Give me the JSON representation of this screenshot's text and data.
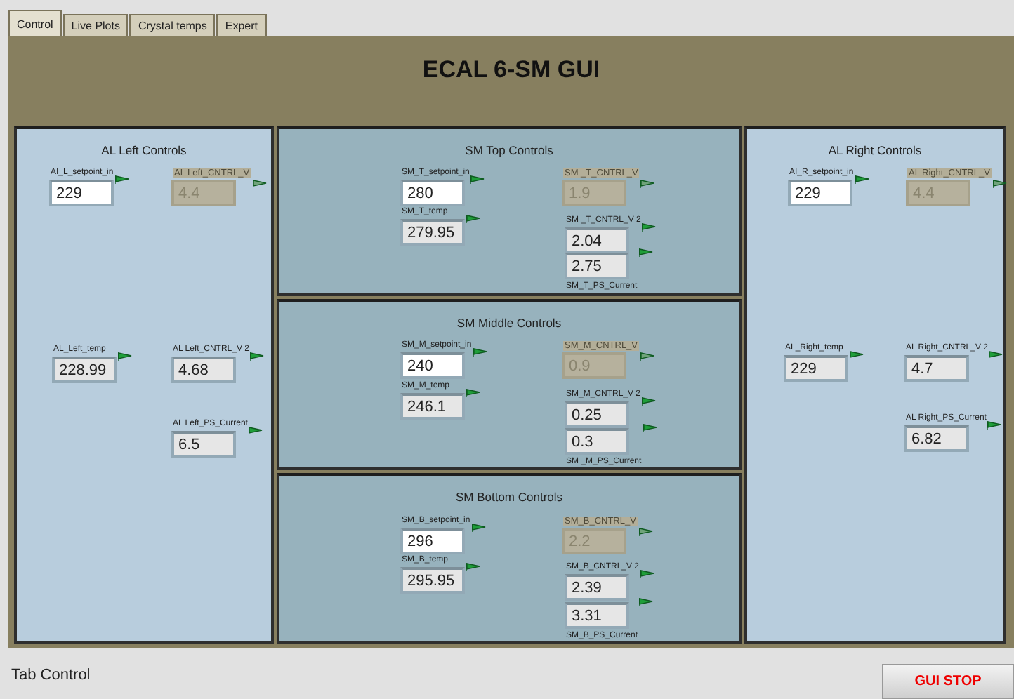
{
  "tabs": [
    {
      "label": "Control",
      "selected": true
    },
    {
      "label": "Live Plots",
      "selected": false
    },
    {
      "label": "Crystal temps",
      "selected": false
    },
    {
      "label": "Expert",
      "selected": false
    }
  ],
  "title": "ECAL 6-SM GUI",
  "columns": [
    {
      "panels": [
        {
          "title": "AL Left Controls",
          "controls": [
            {
              "label": "AI_L_setpoint_in",
              "value": "229",
              "kind": "control",
              "label_below": false
            },
            {
              "label": "AL Left_CNTRL_V",
              "value": "4.4",
              "kind": "disabled",
              "label_below": false
            },
            {
              "label": "AL_Left_temp",
              "value": "228.99",
              "kind": "indicator",
              "label_below": false
            },
            {
              "label": "AL Left_CNTRL_V 2",
              "value": "4.68",
              "kind": "indicator",
              "label_below": false
            },
            {
              "label": "AL Left_PS_Current",
              "value": "6.5",
              "kind": "indicator",
              "label_below": false
            }
          ]
        }
      ]
    },
    {
      "panels": [
        {
          "title": "SM Top Controls",
          "controls": [
            {
              "label": "SM_T_setpoint_in",
              "value": "280",
              "kind": "control",
              "label_below": false
            },
            {
              "label": "SM_T_temp",
              "value": "279.95",
              "kind": "indicator",
              "label_below": false
            },
            {
              "label": "SM _T_CNTRL_V",
              "value": "1.9",
              "kind": "disabled",
              "label_below": false
            },
            {
              "label": "SM _T_CNTRL_V 2",
              "value": "2.04",
              "kind": "indicator",
              "label_below": false
            },
            {
              "label": "SM_T_PS_Current",
              "value": "2.75",
              "kind": "indicator",
              "label_below": true
            }
          ]
        },
        {
          "title": "SM Middle Controls",
          "controls": [
            {
              "label": "SM_M_setpoint_in",
              "value": "240",
              "kind": "control",
              "label_below": false
            },
            {
              "label": "SM_M_temp",
              "value": "246.1",
              "kind": "indicator",
              "label_below": false
            },
            {
              "label": "SM_M_CNTRL_V",
              "value": "0.9",
              "kind": "disabled",
              "label_below": false
            },
            {
              "label": "SM_M_CNTRL_V 2",
              "value": "0.25",
              "kind": "indicator",
              "label_below": false
            },
            {
              "label": "SM _M_PS_Current",
              "value": "0.3",
              "kind": "indicator",
              "label_below": true
            }
          ]
        },
        {
          "title": "SM Bottom Controls",
          "controls": [
            {
              "label": "SM_B_setpoint_in",
              "value": "296",
              "kind": "control",
              "label_below": false
            },
            {
              "label": "SM_B_temp",
              "value": "295.95",
              "kind": "indicator",
              "label_below": false
            },
            {
              "label": "SM_B_CNTRL_V",
              "value": "2.2",
              "kind": "disabled",
              "label_below": false
            },
            {
              "label": "SM_B_CNTRL_V 2",
              "value": "2.39",
              "kind": "indicator",
              "label_below": false
            },
            {
              "label": "SM_B_PS_Current",
              "value": "3.31",
              "kind": "indicator",
              "label_below": true
            }
          ]
        }
      ]
    },
    {
      "panels": [
        {
          "title": "AL Right Controls",
          "controls": [
            {
              "label": "AI_R_setpoint_in",
              "value": "229",
              "kind": "control",
              "label_below": false
            },
            {
              "label": "AL Right_CNTRL_V",
              "value": "4.4",
              "kind": "disabled",
              "label_below": false
            },
            {
              "label": "AL_Right_temp",
              "value": "229",
              "kind": "indicator",
              "label_below": false
            },
            {
              "label": "AL Right_CNTRL_V 2",
              "value": "4.7",
              "kind": "indicator",
              "label_below": false
            },
            {
              "label": "AL Right_PS_Current",
              "value": "6.82",
              "kind": "indicator",
              "label_below": false
            }
          ]
        }
      ]
    }
  ],
  "status_label": "Tab Control",
  "stop_button": "GUI STOP"
}
